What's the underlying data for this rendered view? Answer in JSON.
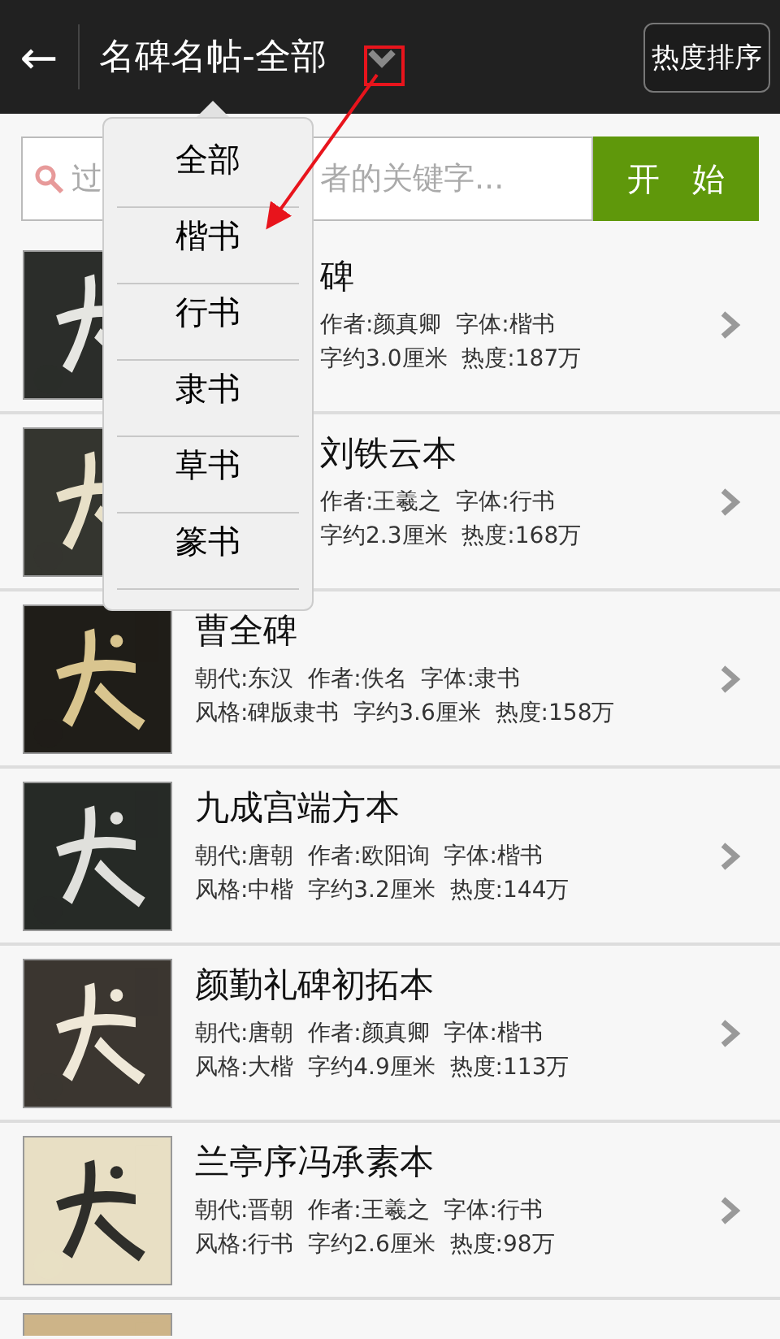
{
  "header": {
    "back": "←",
    "title": "名碑名帖-全部",
    "sort_button": "热度排序"
  },
  "search": {
    "placeholder_lead": "过",
    "placeholder": "者的关键字...",
    "covered": true,
    "button": "开 始"
  },
  "menu": {
    "items": [
      "全部",
      "楷书",
      "行书",
      "隶书",
      "草书",
      "篆书"
    ]
  },
  "items": [
    {
      "thumbnail": {
        "kind": "picture"
      },
      "covered": true,
      "title": "碑",
      "line_1": "作者:颜真卿  字体:楷书",
      "line_2": "字约3.0厘米  热度:187万"
    },
    {
      "thumbnail": {
        "kind": "picture"
      },
      "covered": true,
      "title": "刘铁云本",
      "line_1": "作者:王羲之  字体:行书",
      "line_2": "字约2.3厘米  热度:168万"
    },
    {
      "thumbnail": {
        "kind": "picture"
      },
      "title": "曹全碑",
      "line_1": "朝代:东汉  作者:佚名  字体:隶书",
      "line_2": "风格:碑版隶书  字约3.6厘米  热度:158万"
    },
    {
      "thumbnail": {
        "kind": "picture"
      },
      "title": "九成宫端方本",
      "line_1": "朝代:唐朝  作者:欧阳询  字体:楷书",
      "line_2": "风格:中楷  字约3.2厘米  热度:144万"
    },
    {
      "thumbnail": {
        "kind": "picture"
      },
      "title": "颜勤礼碑初拓本",
      "line_1": "朝代:唐朝  作者:颜真卿  字体:楷书",
      "line_2": "风格:大楷  字约4.9厘米  热度:113万"
    },
    {
      "thumbnail": {
        "kind": "picture"
      },
      "title": "兰亭序冯承素本",
      "line_1": "朝代:晋朝  作者:王羲之  字体:行书",
      "line_2": "风格:行书  字约2.6厘米  热度:98万"
    },
    {
      "thumbnail": {
        "kind": "picture"
      }
    }
  ]
}
